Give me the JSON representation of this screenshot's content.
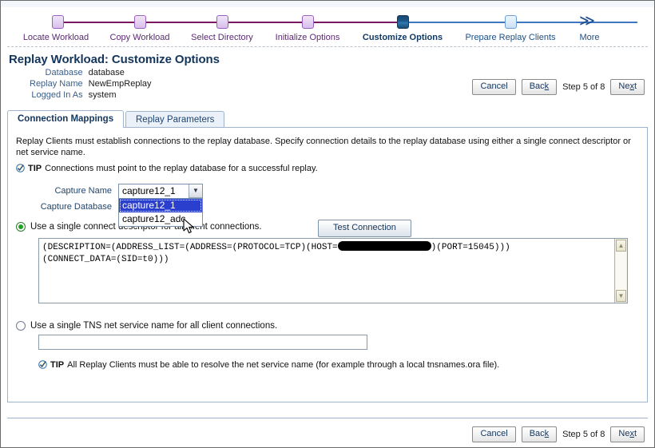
{
  "train": {
    "steps": [
      {
        "label": "Locate Workload",
        "state": "done"
      },
      {
        "label": "Copy Workload",
        "state": "done"
      },
      {
        "label": "Select Directory",
        "state": "done"
      },
      {
        "label": "Initialize Options",
        "state": "done"
      },
      {
        "label": "Customize Options",
        "state": "current"
      },
      {
        "label": "Prepare Replay Clients",
        "state": "future"
      },
      {
        "label": "More",
        "state": "more"
      }
    ],
    "more_glyph": "≫",
    "done_color": "#7b1a63",
    "future_color": "#3f76c0",
    "current_color": "#1d5a8c"
  },
  "header": {
    "title": "Replay Workload: Customize Options",
    "properties": [
      {
        "label": "Database",
        "value": "database"
      },
      {
        "label": "Replay Name",
        "value": "NewEmpReplay"
      },
      {
        "label": "Logged In As",
        "value": "system"
      }
    ]
  },
  "actions": {
    "cancel_label": "Cancel",
    "back_label_pre": "Bac",
    "back_label_key": "k",
    "step_text": "Step 5 of 8",
    "next_label_pre": "Ne",
    "next_label_key": "x",
    "next_label_post": "t"
  },
  "tabs": [
    {
      "label": "Connection Mappings",
      "active": true
    },
    {
      "label": "Replay Parameters",
      "active": false
    }
  ],
  "panel": {
    "intro": "Replay Clients must establish connections to the replay database. Specify connection details to the replay database using either a single connect descriptor or net service name.",
    "tip_word": "TIP",
    "tip_text": "Connections must point to the replay database for a successful replay.",
    "capture_name_label": "Capture Name",
    "capture_database_label": "Capture Database",
    "capture_name_value": "capture12_1",
    "dropdown_options": [
      "capture12_1",
      "capture12_adc"
    ],
    "dropdown_selected_index": 0,
    "dropdown_open": true,
    "radio_descriptor_label": "Use a single connect descriptor for all client connections.",
    "radio_descriptor_checked": true,
    "test_connection_label": "Test Connection",
    "descriptor_line1_pre": "(DESCRIPTION=(ADDRESS_LIST=(ADDRESS=(PROTOCOL=TCP)(HOST=",
    "descriptor_redacted": true,
    "descriptor_line1_post": ")(PORT=15045)))",
    "descriptor_line2": "(CONNECT_DATA=(SID=t0)))",
    "radio_tns_label": "Use a single TNS net service name for all client connections.",
    "radio_tns_checked": false,
    "tns_value": "",
    "tns_tip_word": "TIP",
    "tns_tip_text": "All Replay Clients must be able to resolve the net service name (for example through a local tnsnames.ora file).",
    "scroll_up_glyph": "▲",
    "scroll_down_glyph": "▼",
    "combo_arrow_glyph": "▼"
  }
}
